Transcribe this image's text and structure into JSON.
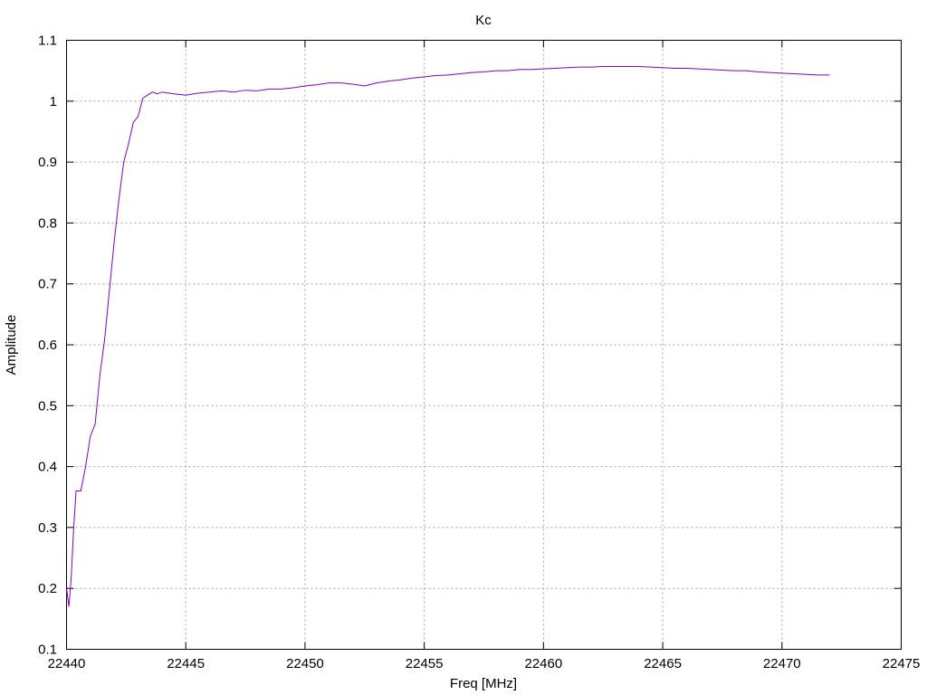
{
  "chart_data": {
    "type": "line",
    "title": "Kc",
    "xlabel": "Freq [MHz]",
    "ylabel": "Amplitude",
    "xlim": [
      22440,
      22475
    ],
    "ylim": [
      0.1,
      1.1
    ],
    "xticks": [
      22440,
      22445,
      22450,
      22455,
      22460,
      22465,
      22470,
      22475
    ],
    "yticks": [
      0.1,
      0.2,
      0.3,
      0.4,
      0.5,
      0.6,
      0.7,
      0.8,
      0.9,
      1,
      1.1
    ],
    "xtick_labels": [
      "22440",
      "22445",
      "22450",
      "22455",
      "22460",
      "22465",
      "22470",
      "22475"
    ],
    "ytick_labels": [
      "0.1",
      "0.2",
      "0.3",
      "0.4",
      "0.5",
      "0.6",
      "0.7",
      "0.8",
      "0.9",
      "1",
      "1.1"
    ],
    "grid": true,
    "colors": {
      "series": "#8000c0"
    },
    "series": [
      {
        "x": [
          22440.0,
          22440.1,
          22440.2,
          22440.3,
          22440.4,
          22440.6,
          22440.8,
          22441.0,
          22441.2,
          22441.4,
          22441.6,
          22441.8,
          22442.0,
          22442.2,
          22442.4,
          22442.6,
          22442.8,
          22443.0,
          22443.2,
          22443.4,
          22443.6,
          22443.8,
          22444.0,
          22444.5,
          22445.0,
          22445.5,
          22446.0,
          22446.5,
          22447.0,
          22447.5,
          22448.0,
          22448.5,
          22449.0,
          22449.5,
          22450.0,
          22450.5,
          22451.0,
          22451.5,
          22452.0,
          22452.5,
          22453.0,
          22453.5,
          22454.0,
          22454.5,
          22455.0,
          22455.5,
          22456.0,
          22456.5,
          22457.0,
          22457.5,
          22458.0,
          22458.5,
          22459.0,
          22459.5,
          22460.0,
          22460.5,
          22461.0,
          22461.5,
          22462.0,
          22462.5,
          22463.0,
          22463.5,
          22464.0,
          22464.5,
          22465.0,
          22465.5,
          22466.0,
          22466.5,
          22467.0,
          22467.5,
          22468.0,
          22468.5,
          22469.0,
          22469.5,
          22470.0,
          22470.5,
          22471.0,
          22471.5,
          22472.0
        ],
        "y": [
          0.2,
          0.17,
          0.22,
          0.3,
          0.36,
          0.36,
          0.4,
          0.45,
          0.47,
          0.55,
          0.61,
          0.69,
          0.77,
          0.84,
          0.9,
          0.93,
          0.965,
          0.975,
          1.005,
          1.01,
          1.015,
          1.012,
          1.015,
          1.012,
          1.01,
          1.013,
          1.015,
          1.017,
          1.015,
          1.018,
          1.017,
          1.02,
          1.02,
          1.022,
          1.025,
          1.027,
          1.03,
          1.03,
          1.028,
          1.025,
          1.03,
          1.033,
          1.035,
          1.038,
          1.04,
          1.042,
          1.043,
          1.045,
          1.047,
          1.048,
          1.05,
          1.05,
          1.052,
          1.052,
          1.053,
          1.054,
          1.055,
          1.056,
          1.056,
          1.057,
          1.057,
          1.057,
          1.057,
          1.056,
          1.055,
          1.054,
          1.054,
          1.053,
          1.052,
          1.051,
          1.05,
          1.05,
          1.048,
          1.047,
          1.046,
          1.045,
          1.044,
          1.043,
          1.043
        ]
      }
    ]
  }
}
